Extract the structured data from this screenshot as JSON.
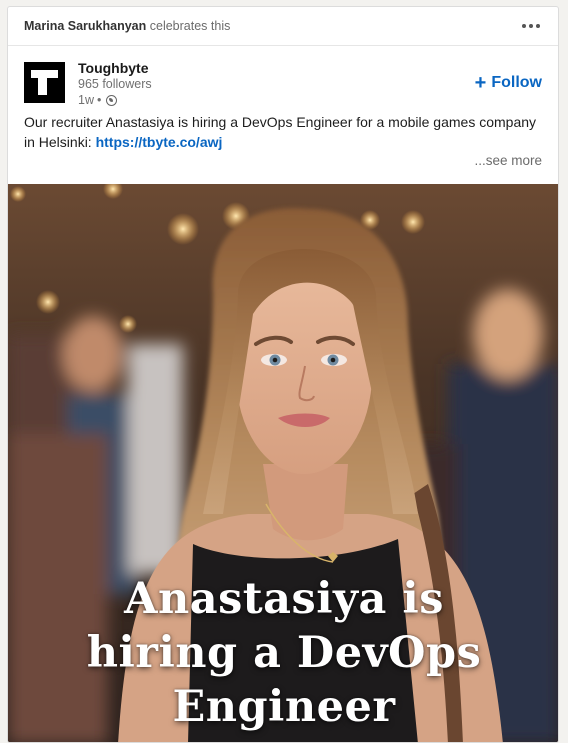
{
  "social_header": {
    "actor": "Marina Sarukhanyan",
    "action": "celebrates this"
  },
  "company": {
    "name": "Toughbyte",
    "followers": "965 followers",
    "time": "1w",
    "separator": "•",
    "visibility_icon": "globe-icon"
  },
  "follow": {
    "icon": "plus-icon",
    "label": "Follow"
  },
  "post": {
    "text": "Our recruiter Anastasiya is hiring a DevOps Engineer for a mobile games company in Helsinki: ",
    "link": "https://tbyte.co/awj",
    "see_more": "...see more"
  },
  "image": {
    "overlay_lines": [
      "Anastasiya is",
      "hiring a DevOps",
      "Engineer"
    ]
  },
  "colors": {
    "link": "#0a66c2",
    "logo_bg": "#000000"
  }
}
